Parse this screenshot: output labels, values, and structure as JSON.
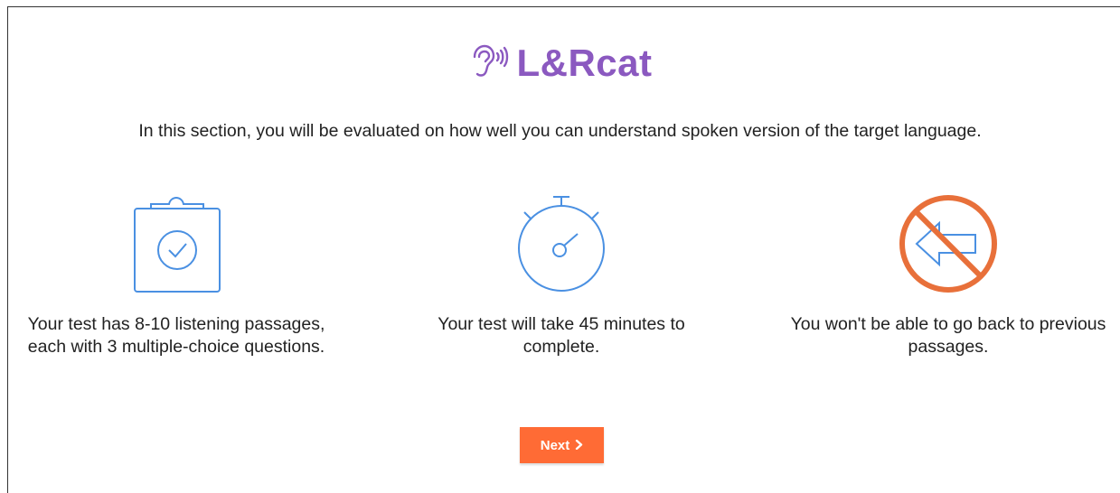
{
  "brand": {
    "name": "L&Rcat",
    "icon": "ear-sound-icon",
    "color": "#8b59c0"
  },
  "intro": "In this section, you will be evaluated on how well you can understand spoken version of the target language.",
  "features": [
    {
      "icon": "clipboard-check-icon",
      "text": "Your test has 8-10 listening passages, each with 3 multiple-choice questions.",
      "color": "#4a90e2"
    },
    {
      "icon": "stopwatch-icon",
      "text": "Your test will take 45 minutes to complete.",
      "color": "#4a90e2"
    },
    {
      "icon": "no-going-back-icon",
      "text": "You won't be able to go back to previous passages.",
      "color": "#e8703a"
    }
  ],
  "next_button": {
    "label": "Next",
    "icon": "chevron-right-icon",
    "color": "#ff6b35"
  }
}
